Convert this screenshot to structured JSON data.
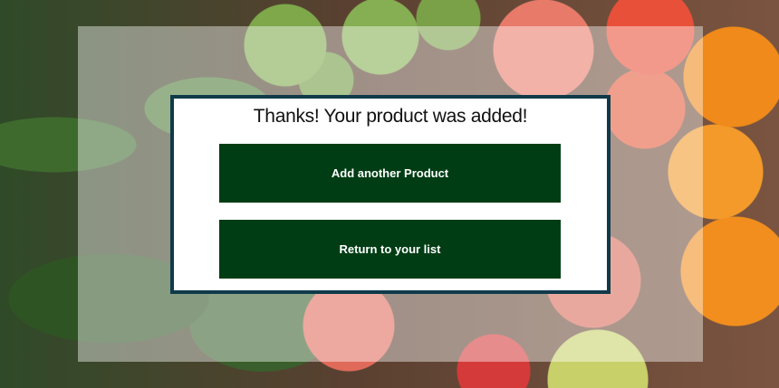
{
  "dialog": {
    "title": "Thanks! Your product was added!",
    "buttons": {
      "add_another": "Add another Product",
      "return_list": "Return to your list"
    }
  },
  "colors": {
    "button_bg": "#003d14",
    "button_text": "#ffffff",
    "dialog_border": "#0f3a4a"
  }
}
